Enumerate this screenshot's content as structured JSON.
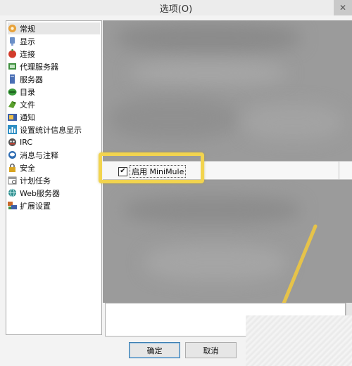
{
  "window": {
    "title": "选项(O)",
    "close_glyph": "✕"
  },
  "tree": {
    "items": [
      {
        "label": "常规",
        "icon": "gear-icon",
        "color": "#e8a23a",
        "selected": true
      },
      {
        "label": "显示",
        "icon": "display-icon",
        "color": "#6b8fc7"
      },
      {
        "label": "连接",
        "icon": "connection-icon",
        "color": "#d23b2b"
      },
      {
        "label": "代理服务器",
        "icon": "proxy-icon",
        "color": "#3f8f3f"
      },
      {
        "label": "服务器",
        "icon": "server-icon",
        "color": "#4a6fb5"
      },
      {
        "label": "目录",
        "icon": "folder-icon",
        "color": "#3a9a3a"
      },
      {
        "label": "文件",
        "icon": "file-icon",
        "color": "#5aa02c"
      },
      {
        "label": "通知",
        "icon": "notification-icon",
        "color": "#3d5fa8"
      },
      {
        "label": "设置统计信息显示",
        "icon": "statistics-icon",
        "color": "#2f8fc4"
      },
      {
        "label": "IRC",
        "icon": "irc-icon",
        "color": "#555555"
      },
      {
        "label": "消息与注释",
        "icon": "message-icon",
        "color": "#2f6db3"
      },
      {
        "label": "安全",
        "icon": "lock-icon",
        "color": "#d9a521"
      },
      {
        "label": "计划任务",
        "icon": "calendar-icon",
        "color": "#7a7a7a"
      },
      {
        "label": "Web服务器",
        "icon": "web-icon",
        "color": "#2f8f8f"
      },
      {
        "label": "扩展设置",
        "icon": "extension-icon",
        "color": "#c8672a"
      }
    ]
  },
  "option": {
    "label": "启用 MiniMule",
    "checked": true,
    "check_glyph": "✔"
  },
  "buttons": {
    "ok": "确定",
    "cancel": "取消"
  },
  "colors": {
    "highlight": "#f2d44e",
    "panel_blur": "#9b9b9b"
  }
}
